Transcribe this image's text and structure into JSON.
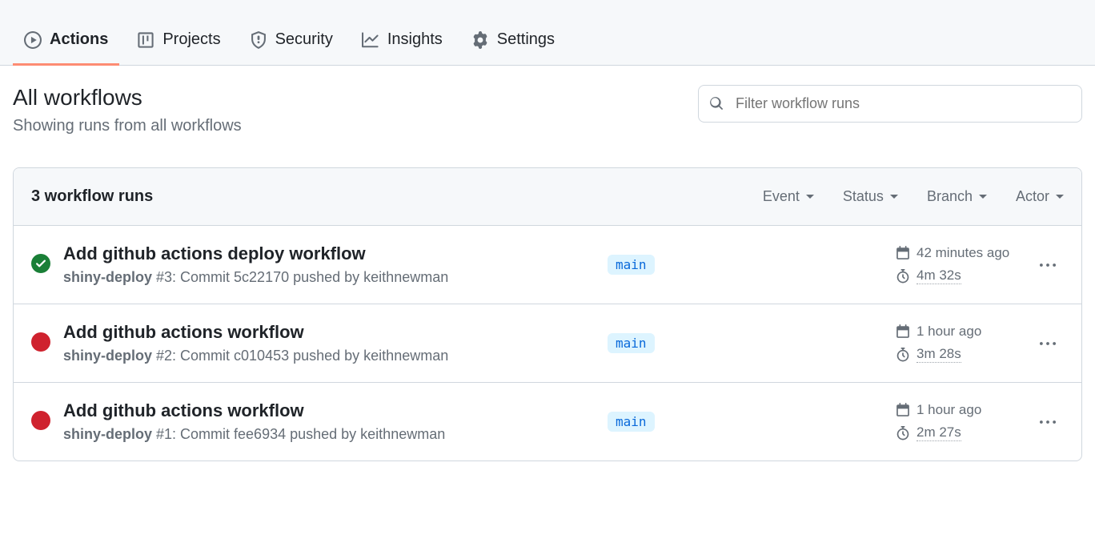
{
  "tabs": [
    {
      "label": "Actions",
      "icon": "play-icon",
      "active": true
    },
    {
      "label": "Projects",
      "icon": "project-icon",
      "active": false
    },
    {
      "label": "Security",
      "icon": "shield-icon",
      "active": false
    },
    {
      "label": "Insights",
      "icon": "graph-icon",
      "active": false
    },
    {
      "label": "Settings",
      "icon": "gear-icon",
      "active": false
    }
  ],
  "header": {
    "title": "All workflows",
    "subtitle": "Showing runs from all workflows"
  },
  "search": {
    "placeholder": "Filter workflow runs"
  },
  "list": {
    "count_label": "3 workflow runs",
    "filters": [
      "Event",
      "Status",
      "Branch",
      "Actor"
    ]
  },
  "runs": [
    {
      "status": "success",
      "title": "Add github actions deploy workflow",
      "workflow": "shiny-deploy",
      "meta_rest": " #3: Commit 5c22170 pushed by keithnewman",
      "branch": "main",
      "time": "42 minutes ago",
      "duration": "4m 32s"
    },
    {
      "status": "failure",
      "title": "Add github actions workflow",
      "workflow": "shiny-deploy",
      "meta_rest": " #2: Commit c010453 pushed by keithnewman",
      "branch": "main",
      "time": "1 hour ago",
      "duration": "3m 28s"
    },
    {
      "status": "failure",
      "title": "Add github actions workflow",
      "workflow": "shiny-deploy",
      "meta_rest": " #1: Commit fee6934 pushed by keithnewman",
      "branch": "main",
      "time": "1 hour ago",
      "duration": "2m 27s"
    }
  ]
}
